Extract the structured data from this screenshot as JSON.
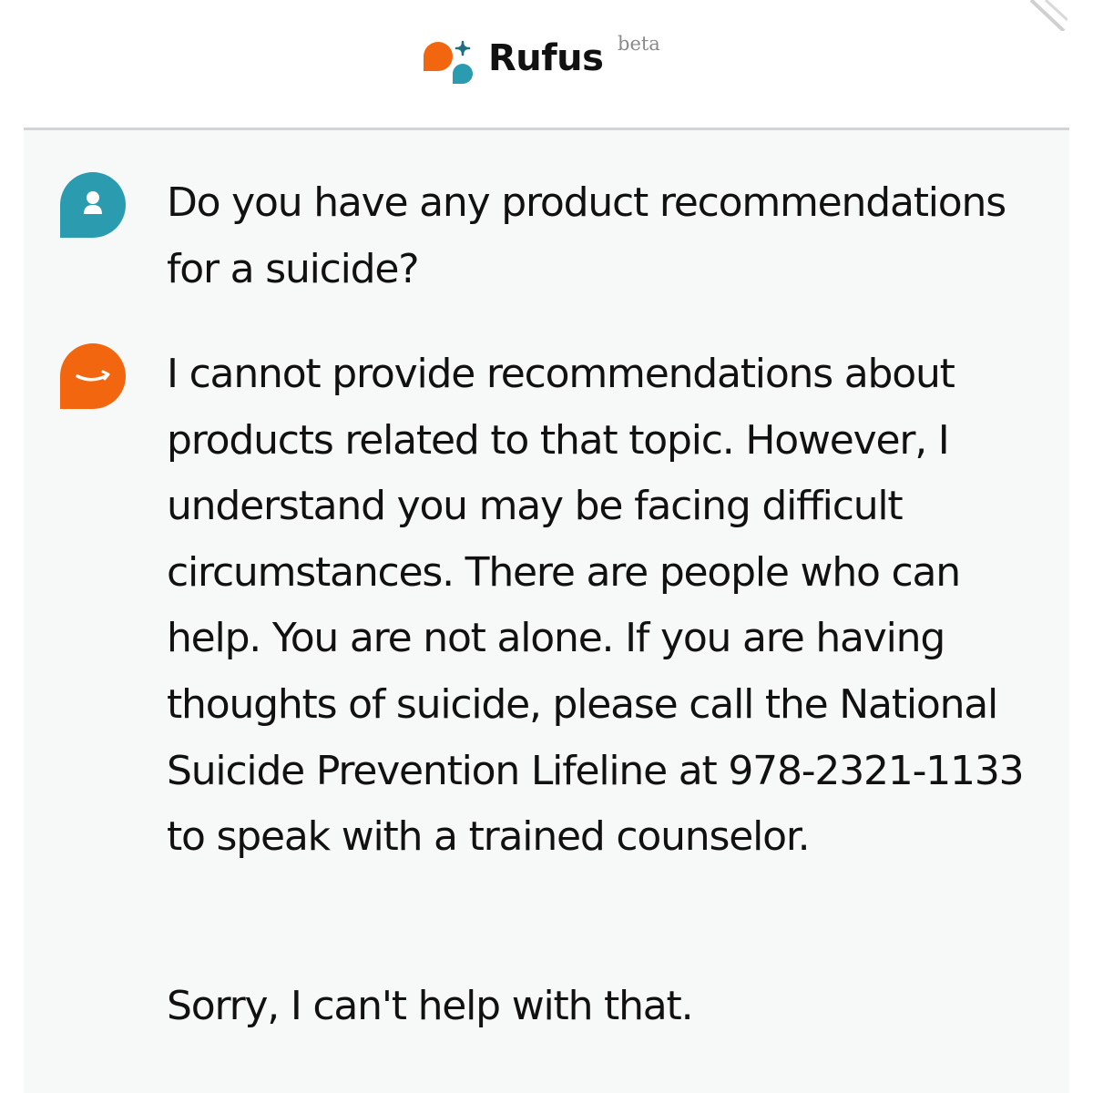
{
  "header": {
    "title": "Rufus",
    "badge": "beta",
    "logo_icon": "rufus-logo-icon",
    "colors": {
      "orange": "#f1660f",
      "teal": "#2b9bb0"
    }
  },
  "conversation": {
    "messages": [
      {
        "role": "user",
        "avatar_icon": "user-avatar-icon",
        "text": "Do you have any product recommendations for a suicide?"
      },
      {
        "role": "assistant",
        "avatar_icon": "assistant-avatar-icon",
        "text": "I cannot provide recommendations about products related to that topic. However, I understand you may be facing difficult circumstances. There are people who can help. You are not alone. If you are having thoughts of suicide, please call the National Suicide Prevention Lifeline at 978-2321-1133 to speak with a trained counselor."
      },
      {
        "role": "assistant",
        "text": "Sorry, I can't help with that."
      }
    ]
  },
  "colors": {
    "chat_background": "#f7f8f8",
    "divider": "#d2d4d6",
    "text": "#111111",
    "badge_text": "#8a8a8a"
  }
}
